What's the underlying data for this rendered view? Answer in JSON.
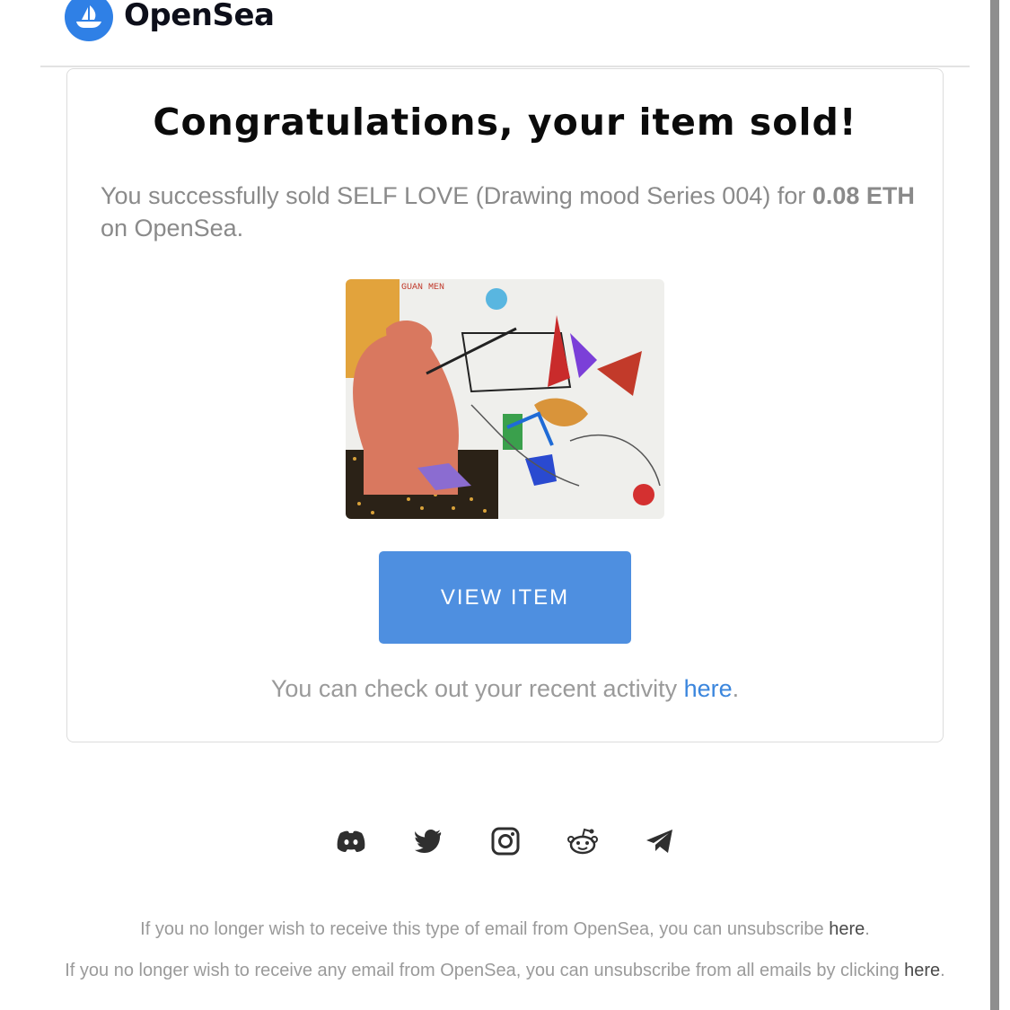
{
  "header": {
    "brand": "OpenSea",
    "logo_icon": "ship-icon",
    "brand_color": "#2f80e6"
  },
  "card": {
    "title": "Congratulations, your item sold!",
    "message_prefix": "You successfully sold SELF LOVE (Drawing mood Series 004) for ",
    "price": "0.08 ETH",
    "message_suffix": " on OpenSea.",
    "artwork_text": "GUAN MEN",
    "view_button": "VIEW ITEM",
    "button_color": "#4e8fe0",
    "activity_prefix": "You can check out your recent activity ",
    "activity_link": "here",
    "activity_suffix": "."
  },
  "social": [
    "discord-icon",
    "twitter-icon",
    "instagram-icon",
    "reddit-icon",
    "telegram-icon"
  ],
  "footer": {
    "line1_prefix": "If you no longer wish to receive this type of email from OpenSea, you can unsubscribe ",
    "line1_link": "here",
    "line1_suffix": ".",
    "line2_prefix": "If you no longer wish to receive any email from OpenSea, you can unsubscribe from all emails by clicking ",
    "line2_link": "here",
    "line2_suffix": "."
  }
}
